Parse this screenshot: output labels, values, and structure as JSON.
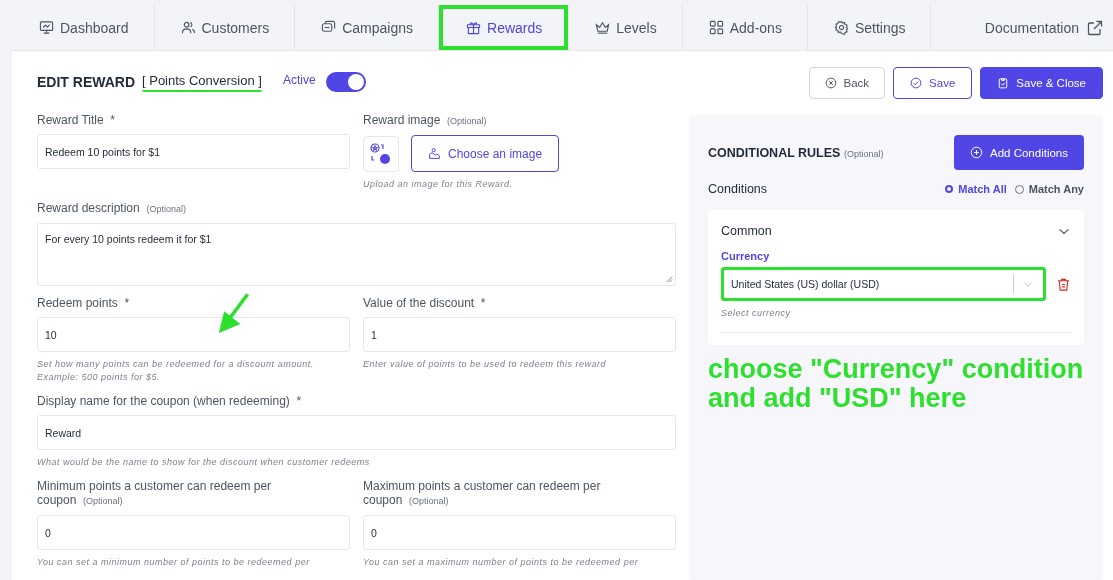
{
  "nav": {
    "tabs": [
      {
        "label": "Dashboard",
        "selected": false,
        "highlighted": false
      },
      {
        "label": "Customers",
        "selected": false,
        "highlighted": false
      },
      {
        "label": "Campaigns",
        "selected": false,
        "highlighted": false
      },
      {
        "label": "Rewards",
        "selected": true,
        "highlighted": true
      },
      {
        "label": "Levels",
        "selected": false,
        "highlighted": false
      },
      {
        "label": "Add-ons",
        "selected": false,
        "highlighted": false
      },
      {
        "label": "Settings",
        "selected": false,
        "highlighted": false
      }
    ],
    "documentation": "Documentation"
  },
  "header": {
    "title": "EDIT REWARD",
    "name": "[ Points Conversion ]",
    "name_underlined": true,
    "active_label": "Active",
    "active": true,
    "buttons": [
      {
        "label": "Back",
        "kind": "plain"
      },
      {
        "label": "Save",
        "kind": "outline"
      },
      {
        "label": "Save & Close",
        "kind": "primary"
      }
    ]
  },
  "form": {
    "rows": [
      {
        "fields": [
          {
            "kind": "input",
            "label": "Reward Title",
            "required": "*",
            "value": "Redeem 10 points for $1"
          },
          {
            "kind": "image",
            "label": "Reward image",
            "optional": "(Optional)",
            "button": "Choose an image",
            "help": "Upload an image for this Reward."
          }
        ]
      },
      {
        "fields": [
          {
            "kind": "textarea",
            "label": "Reward description",
            "optional": "(Optional)",
            "value": "For every 10 points redeem it for $1"
          }
        ]
      },
      {
        "fields": [
          {
            "kind": "input",
            "label": "Redeem points",
            "required": "*",
            "value": "10",
            "help": "Set how many points can be redeemed for a discount amount. Example: 500 points for $5.",
            "arrow": true
          },
          {
            "kind": "input",
            "label": "Value of the discount",
            "required": "*",
            "value": "1",
            "help": "Enter value of points to be used to redeem this reward"
          }
        ]
      },
      {
        "fields": [
          {
            "kind": "input",
            "label": "Display name for the coupon (when redeeming)",
            "required": "*",
            "value": "Reward",
            "help": "What would be the name to show for the discount when customer redeems"
          }
        ]
      },
      {
        "fields": [
          {
            "kind": "input",
            "label": "Minimum points a customer can redeem per coupon",
            "optional": "(Optional)",
            "value": "0",
            "help": "You can set a minimum number of points to be redeemed per"
          },
          {
            "kind": "input",
            "label": "Maximum points a customer can redeem per coupon",
            "optional": "(Optional)",
            "value": "0",
            "help": "You can set a maximum number of points to be redeemed per"
          }
        ]
      }
    ]
  },
  "rules": {
    "title": "CONDITIONAL RULES",
    "optional": "(Optional)",
    "add_button": "Add Conditions",
    "conditions_label": "Conditions",
    "match": [
      {
        "label": "Match All",
        "selected": true
      },
      {
        "label": "Match Any",
        "selected": false
      }
    ],
    "group": {
      "title": "Common",
      "expanded": true,
      "field_label": "Currency",
      "value": "United States (US) dollar (USD)",
      "highlighted": true,
      "help": "Select currency"
    },
    "note": "choose \"Currency\" condition and add \"USD\" here"
  }
}
